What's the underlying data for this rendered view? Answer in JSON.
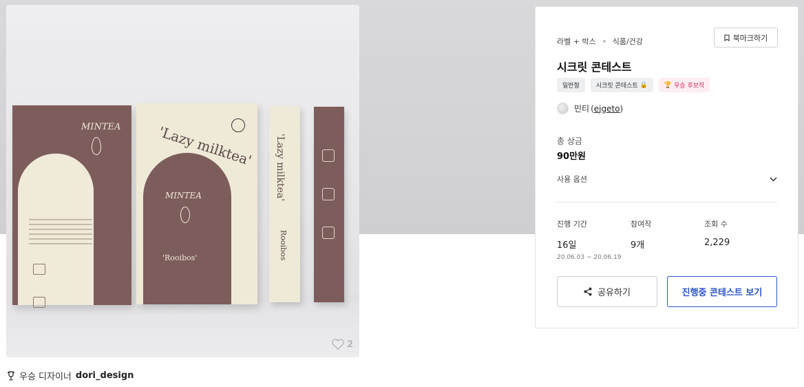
{
  "product": {
    "likes": "2"
  },
  "designer": {
    "prefix": "우승 디자이너",
    "name": "dori_design"
  },
  "panel": {
    "breadcrumb": [
      "라벨 + 박스",
      "식품/건강"
    ],
    "bookmark_label": "북마크하기",
    "title": "시크릿 콘테스트",
    "tags": [
      "일반형",
      "시크릿 콘테스트",
      "우승 후보작"
    ],
    "owner_name": "민티",
    "owner_id": "ejgeto",
    "prize_label": "총 상금",
    "prize_value": "90만원",
    "usage_label": "사용 옵션",
    "stats": [
      {
        "label": "진행 기간",
        "value": "16일",
        "sub": "20.06.03 ~ 20.06.19"
      },
      {
        "label": "참여작",
        "value": "9개",
        "sub": ""
      },
      {
        "label": "조회 수",
        "value": "2,229",
        "sub": ""
      }
    ],
    "share_label": "공유하기",
    "view_label": "진행중 콘테스트 보기"
  },
  "colors": {
    "accent": "#2c55c8",
    "winner_tag": "#d0305a",
    "product_brown": "#7d5d5c",
    "product_cream": "#efe9d8"
  }
}
